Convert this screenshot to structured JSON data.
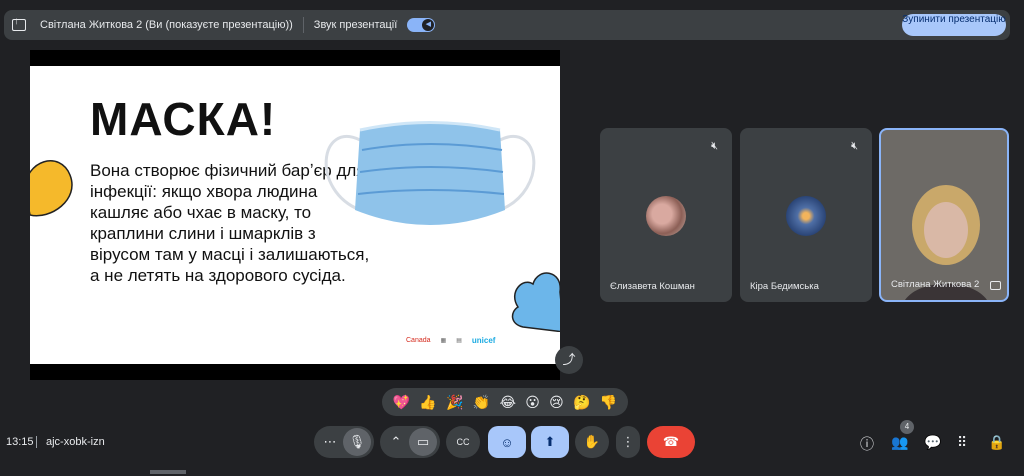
{
  "topbar": {
    "presenter_text": "Світлана Житкова 2 (Ви (показуєте презентацію))",
    "sound_label": "Звук презентації",
    "stop_button": "Зупинити презентацію"
  },
  "slide": {
    "title": "МАСКА!",
    "body": "Вона створює фізичний барʼєр для інфекції: якщо хвора людина кашляє або чхає в маску, то краплини слини і шмарклів з вірусом там у масці і залишаються, а не летять на здорового сусіда.",
    "logos": [
      "Canada",
      "unicef"
    ]
  },
  "participants": [
    {
      "name": "Єлизавета Кошман",
      "muted": true
    },
    {
      "name": "Кіра Бедимська",
      "muted": true
    },
    {
      "name": "Світлана Житкова 2"
    }
  ],
  "reactions": [
    "💖",
    "👍",
    "🎉",
    "👏",
    "😂",
    "😮",
    "😢",
    "🤔",
    "👎"
  ],
  "meeting": {
    "time": "13:15",
    "code": "ajc-xobk-izn",
    "participant_count": "4"
  },
  "icons": {
    "more": "⋯",
    "mic": "🎙",
    "chevron_up": "⌃",
    "camera": "▭",
    "captions": "CC",
    "emoji": "☺",
    "present": "⬆",
    "hand": "✋",
    "more_vert": "⋮",
    "hangup": "☎",
    "info": "ⓘ",
    "people": "👥",
    "chat": "💬",
    "activities": "⠿",
    "lock": "🔒",
    "share": "⤴",
    "mic_off": "🎙̸"
  },
  "colors": {
    "background": "#202124",
    "accent": "#a8c7fa",
    "hangup": "#ea4335"
  }
}
